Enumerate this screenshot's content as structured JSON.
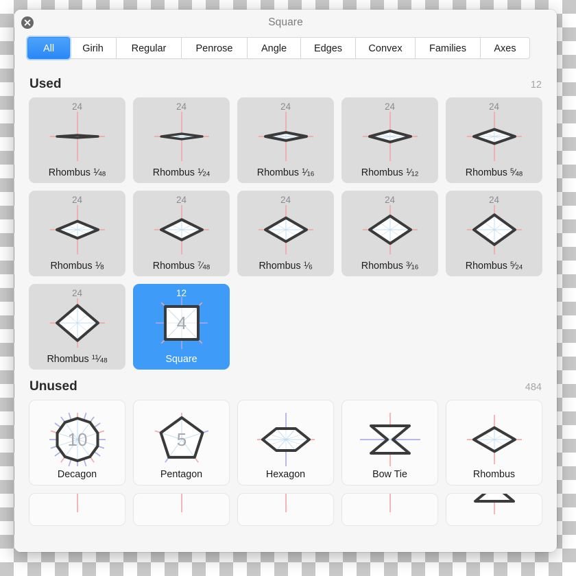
{
  "window": {
    "title": "Square",
    "close_icon": "close-icon"
  },
  "tabs": [
    {
      "label": "All",
      "active": true
    },
    {
      "label": "Girih",
      "active": false
    },
    {
      "label": "Regular",
      "active": false
    },
    {
      "label": "Penrose",
      "active": false
    },
    {
      "label": "Angle",
      "active": false
    },
    {
      "label": "Edges",
      "active": false
    },
    {
      "label": "Convex",
      "active": false
    },
    {
      "label": "Families",
      "active": false
    },
    {
      "label": "Axes",
      "active": false
    }
  ],
  "sections": [
    {
      "title": "Used",
      "count": "12",
      "tiles": [
        {
          "name": "Rhombus",
          "num": "1",
          "den": "48",
          "badge": "24",
          "shape": "rhombus",
          "ratio": 0.0654,
          "inner": "",
          "state": "used"
        },
        {
          "name": "Rhombus",
          "num": "1",
          "den": "24",
          "badge": "24",
          "shape": "rhombus",
          "ratio": 0.1305,
          "inner": "",
          "state": "used"
        },
        {
          "name": "Rhombus",
          "num": "1",
          "den": "16",
          "badge": "24",
          "shape": "rhombus",
          "ratio": 0.1989,
          "inner": "",
          "state": "used"
        },
        {
          "name": "Rhombus",
          "num": "1",
          "den": "12",
          "badge": "24",
          "shape": "rhombus",
          "ratio": 0.2679,
          "inner": "",
          "state": "used"
        },
        {
          "name": "Rhombus",
          "num": "5",
          "den": "48",
          "badge": "24",
          "shape": "rhombus",
          "ratio": 0.3443,
          "inner": "",
          "state": "used"
        },
        {
          "name": "Rhombus",
          "num": "1",
          "den": "8",
          "badge": "24",
          "shape": "rhombus",
          "ratio": 0.4142,
          "inner": "",
          "state": "used"
        },
        {
          "name": "Rhombus",
          "num": "7",
          "den": "48",
          "badge": "24",
          "shape": "rhombus",
          "ratio": 0.495,
          "inner": "",
          "state": "used"
        },
        {
          "name": "Rhombus",
          "num": "1",
          "den": "6",
          "badge": "24",
          "shape": "rhombus",
          "ratio": 0.5774,
          "inner": "",
          "state": "used"
        },
        {
          "name": "Rhombus",
          "num": "3",
          "den": "16",
          "badge": "24",
          "shape": "rhombus",
          "ratio": 0.6682,
          "inner": "",
          "state": "used"
        },
        {
          "name": "Rhombus",
          "num": "5",
          "den": "24",
          "badge": "24",
          "shape": "rhombus",
          "ratio": 0.7265,
          "inner": "",
          "state": "used"
        },
        {
          "name": "Rhombus",
          "num": "11",
          "den": "48",
          "badge": "24",
          "shape": "rhombus",
          "ratio": 0.854,
          "inner": "",
          "state": "used"
        },
        {
          "name": "Square",
          "num": "",
          "den": "",
          "badge": "12",
          "shape": "square",
          "ratio": 1.0,
          "inner": "4",
          "state": "selected"
        }
      ]
    },
    {
      "title": "Unused",
      "count": "484",
      "tiles": [
        {
          "name": "Decagon",
          "num": "",
          "den": "",
          "badge": "",
          "shape": "decagon",
          "ratio": 1.0,
          "inner": "10",
          "state": "unused"
        },
        {
          "name": "Pentagon",
          "num": "",
          "den": "",
          "badge": "",
          "shape": "pentagon",
          "ratio": 1.0,
          "inner": "5",
          "state": "unused"
        },
        {
          "name": "Hexagon",
          "num": "",
          "den": "",
          "badge": "",
          "shape": "hexagon",
          "ratio": 1.0,
          "inner": "",
          "state": "unused"
        },
        {
          "name": "Bow Tie",
          "num": "",
          "den": "",
          "badge": "",
          "shape": "bowtie",
          "ratio": 1.0,
          "inner": "",
          "state": "unused"
        },
        {
          "name": "Rhombus",
          "num": "",
          "den": "",
          "badge": "",
          "shape": "rhombus",
          "ratio": 0.58,
          "inner": "",
          "state": "unused"
        },
        {
          "name": "",
          "num": "",
          "den": "",
          "badge": "",
          "shape": "rhombus",
          "ratio": 0.07,
          "inner": "",
          "state": "unused",
          "partial": true
        },
        {
          "name": "",
          "num": "",
          "den": "",
          "badge": "",
          "shape": "rhombus",
          "ratio": 0.09,
          "inner": "",
          "state": "unused",
          "partial": true
        },
        {
          "name": "",
          "num": "",
          "den": "",
          "badge": "",
          "shape": "rhombus",
          "ratio": 0.1,
          "inner": "",
          "state": "unused",
          "partial": true
        },
        {
          "name": "",
          "num": "",
          "den": "",
          "badge": "",
          "shape": "rhombus",
          "ratio": 0.08,
          "inner": "",
          "state": "unused",
          "partial": true
        },
        {
          "name": "",
          "num": "",
          "den": "",
          "badge": "",
          "shape": "bowtie",
          "ratio": 0.3,
          "inner": "",
          "state": "unused",
          "partial": true
        }
      ]
    }
  ],
  "colors": {
    "accent": "#3e9bf8",
    "tile_used_bg": "#dcdcdc",
    "tile_unused_bg": "#fbfbfb",
    "window_bg": "#f6f6f6",
    "outline": "#3a3a3a",
    "axis_pink": "#f3a6a6",
    "axis_blue": "#a9a9e8",
    "diagonal_blue": "#bcdcee"
  }
}
